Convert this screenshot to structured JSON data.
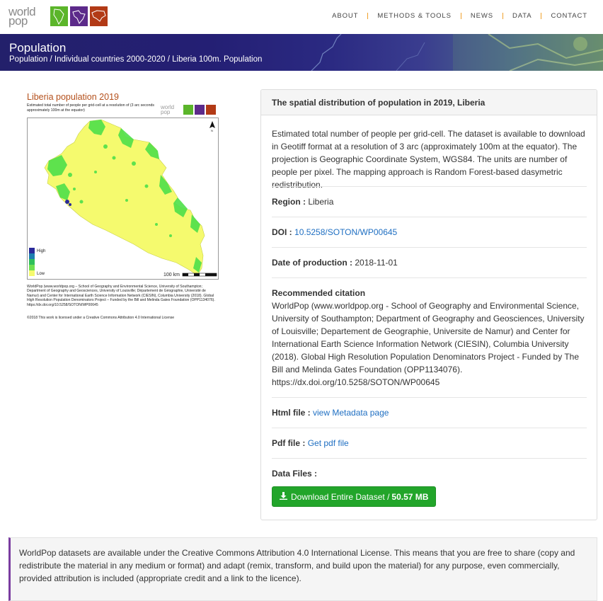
{
  "logo": {
    "line1": "world",
    "line2": "pop"
  },
  "nav": {
    "items": [
      {
        "label": "ABOUT"
      },
      {
        "label": "METHODS & TOOLS"
      },
      {
        "label": "NEWS"
      },
      {
        "label": "DATA"
      },
      {
        "label": "CONTACT"
      }
    ]
  },
  "banner": {
    "title": "Population",
    "breadcrumb": "Population / Individual countries 2000-2020 / Liberia 100m. Population"
  },
  "figure": {
    "title": "Liberia population 2019",
    "subtitle": "Estimated total number of people per grid-cell at a resolution of (3 arc seconds approximately 100m at the equator)",
    "logo_text_1": "world",
    "logo_text_2": "pop",
    "legend_high": "High",
    "legend_low": "Low",
    "scale_label": "100 km",
    "north_label": "N",
    "credit": "WorldPop (www.worldpop.org – School of Geography and Environmental Science, University of Southampton; Department of Geography and Geosciences, University of Louisville; Département de Géographie, Université de Namur) and Center for International Earth Science Information Network (CIESIN), Columbia University (2018). Global High Resolution Population Denominators Project – Funded by the Bill and Melinda Gates Foundation (OPP1134076). https://dx.doi.org/10.5258/SOTON/WP00645",
    "license": "©2018 This work is licensed under a Creative Commons Attribution 4.0 International License"
  },
  "panel": {
    "heading": "The spatial distribution of population in 2019, Liberia",
    "description": "Estimated total number of people per grid-cell. The dataset is available to download in Geotiff format at a resolution of 3 arc (approximately 100m at the equator). The projection is Geographic Coordinate System, WGS84. The units are number of people per pixel. The mapping approach is Random Forest-based dasymetric redistribution.",
    "region_label": "Region :",
    "region_value": "Liberia",
    "doi_label": "DOI :",
    "doi_value": "10.5258/SOTON/WP00645",
    "date_label": "Date of production :",
    "date_value": "2018-11-01",
    "citation_label": "Recommended citation",
    "citation_text": "WorldPop (www.worldpop.org - School of Geography and Environmental Science, University of Southampton; Department of Geography and Geosciences, University of Louisville; Departement de Geographie, Universite de Namur) and Center for International Earth Science Information Network (CIESIN), Columbia University (2018). Global High Resolution Population Denominators Project - Funded by The Bill and Melinda Gates Foundation (OPP1134076). https://dx.doi.org/10.5258/SOTON/WP00645",
    "html_label": "Html file :",
    "html_link": "view Metadata page",
    "pdf_label": "Pdf file :",
    "pdf_link": "Get pdf file",
    "datafiles_label": "Data Files :",
    "download_label": "Download Entire Dataset /",
    "download_size": "50.57 MB"
  },
  "note": {
    "text": "WorldPop datasets are available under the Creative Commons Attribution 4.0 International License. This means that you are free to share (copy and redistribute the material in any medium or format) and adapt (remix, transform, and build upon the material) for any purpose, even commercially, provided attribution is included (appropriate credit and a link to the licence)."
  },
  "colors": {
    "accent_green": "#22a52a",
    "link_blue": "#1f6fc2",
    "banner_navy": "#23206b",
    "nav_separator": "#f0a02a",
    "figure_title": "#b4501c",
    "note_border": "#7a3da0"
  },
  "icons": {
    "download": "download-icon",
    "north_arrow": "north-arrow-icon"
  }
}
